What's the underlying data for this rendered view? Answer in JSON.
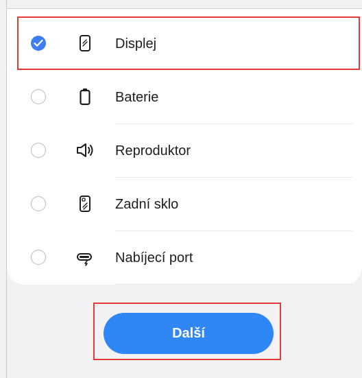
{
  "options": [
    {
      "label": "Displej",
      "icon": "phone-display-icon",
      "selected": true
    },
    {
      "label": "Baterie",
      "icon": "battery-icon",
      "selected": false
    },
    {
      "label": "Reproduktor",
      "icon": "speaker-icon",
      "selected": false
    },
    {
      "label": "Zadní sklo",
      "icon": "phone-back-glass-icon",
      "selected": false
    },
    {
      "label": "Nabíjecí port",
      "icon": "charging-port-icon",
      "selected": false
    }
  ],
  "next_button": {
    "label": "Další"
  },
  "colors": {
    "accent": "#2f86f5",
    "check": "#3e7ef5",
    "highlight": "#e53935"
  }
}
